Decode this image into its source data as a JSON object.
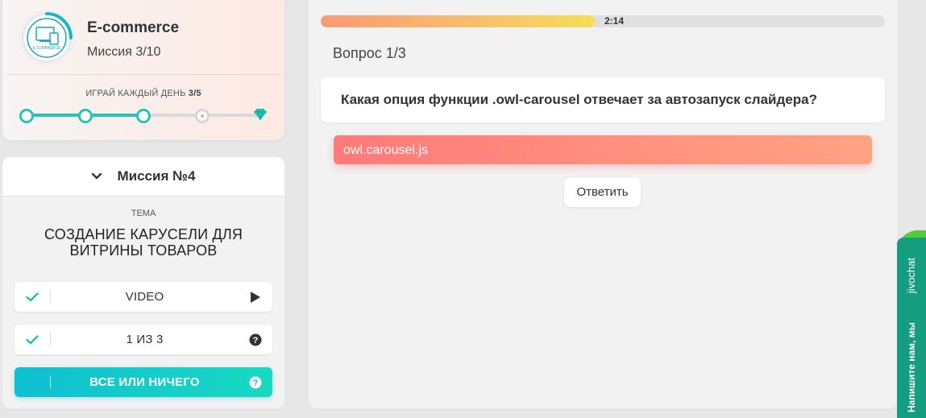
{
  "course": {
    "title": "E-commerce",
    "mission_progress": "Миссия 3/10",
    "logo_icon": "ecommerce-devices-icon",
    "logo_text": "E-COMMERCE"
  },
  "daily": {
    "label": "ИГРАЙ КАЖДЫЙ ДЕНЬ",
    "count": "3/5",
    "completed": 3,
    "total": 5,
    "reward_icon": "diamond-icon"
  },
  "mission": {
    "header": "Миссия №4",
    "topic_label": "ТЕМА",
    "topic_title": "СОЗДАНИЕ КАРУСЕЛИ ДЛЯ ВИТРИНЫ ТОВАРОВ",
    "tasks": [
      {
        "label": "VIDEO",
        "done": true,
        "right_icon": "play-icon"
      },
      {
        "label": "1 ИЗ 3",
        "done": true,
        "right_icon": "help-icon"
      },
      {
        "label": "ВСЕ ИЛИ НИЧЕГО",
        "done": false,
        "right_icon": "help-icon",
        "active": true
      }
    ]
  },
  "quiz": {
    "timer": "2:14",
    "timer_progress": 0.485,
    "question_count": "Вопрос 1/3",
    "question": "Какая опция функции .owl-carousel отвечает за автозапуск слайдера?",
    "answer": "owl.carousel.js",
    "submit_label": "Ответить"
  },
  "colors": {
    "accent_teal": "#24c5b6",
    "answer_gradient_start": "#ff7a7a",
    "answer_gradient_end": "#ffa382",
    "jivo_green": "#149e7f"
  },
  "jivochat": {
    "brand": "jivochat",
    "status": "Напишите нам, мы онлайн!"
  }
}
